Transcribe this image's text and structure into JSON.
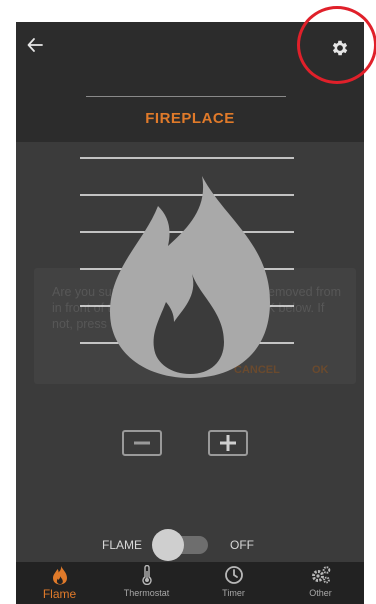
{
  "header": {
    "title": "FIREPLACE"
  },
  "icons": {
    "back": "arrow-left-icon",
    "settings": "gear-icon",
    "flame": "flame-icon",
    "minus": "minus-icon",
    "plus": "plus-icon"
  },
  "dialog": {
    "message": "Are you sure all flammable material is removed from in front of the appliance? If so, press OK below. If not, press cancel.",
    "cancel_label": "CANCEL",
    "ok_label": "OK"
  },
  "toggle": {
    "left_label": "FLAME",
    "right_label": "OFF"
  },
  "bottom_nav": {
    "items": [
      {
        "label": "Flame",
        "icon": "flame-icon",
        "active": true
      },
      {
        "label": "Thermostat",
        "icon": "thermometer-icon",
        "active": false
      },
      {
        "label": "Timer",
        "icon": "clock-icon",
        "active": false
      },
      {
        "label": "Other",
        "icon": "gears-icon",
        "active": false
      }
    ]
  },
  "colors": {
    "accent": "#e07a2a",
    "highlight": "#e0202a",
    "background": "#3b3b3b",
    "nav_background": "#222222"
  }
}
